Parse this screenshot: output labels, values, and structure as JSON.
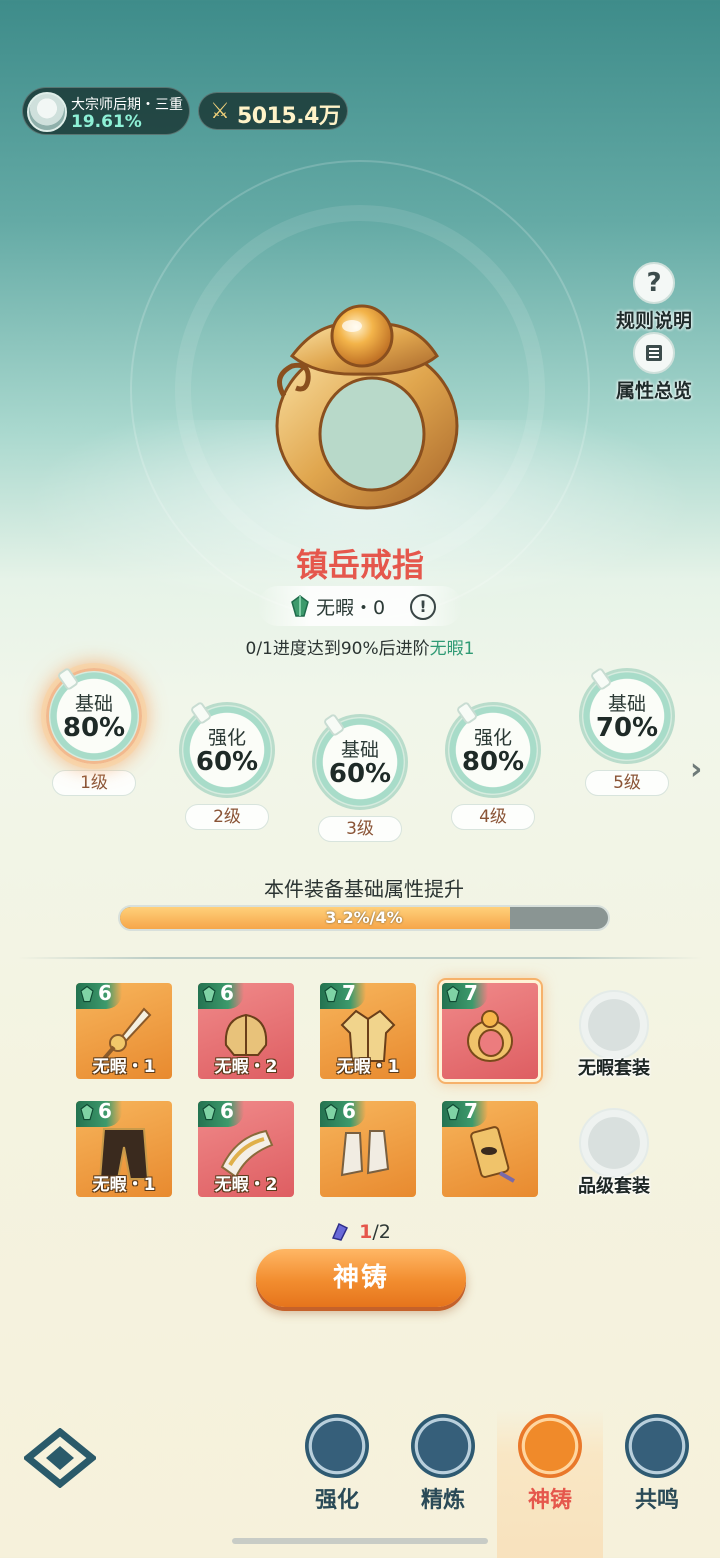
{
  "header": {
    "rank_title": "大宗师后期・三重",
    "rank_progress": "19.61%",
    "power": "5015.4万"
  },
  "side_buttons": {
    "rules_label": "规则说明",
    "attributes_label": "属性总览"
  },
  "item": {
    "name": "镇岳戒指",
    "flaw_label": "无暇・0",
    "progress_prefix": "0/1进度达到90%后进阶",
    "progress_target": "无暇1"
  },
  "stages": [
    {
      "type": "基础",
      "pct": "80%",
      "level": "1级",
      "active": true
    },
    {
      "type": "强化",
      "pct": "60%",
      "level": "2级",
      "active": false
    },
    {
      "type": "基础",
      "pct": "60%",
      "level": "3级",
      "active": false
    },
    {
      "type": "强化",
      "pct": "80%",
      "level": "4级",
      "active": false
    },
    {
      "type": "基础",
      "pct": "70%",
      "level": "5级",
      "active": false
    }
  ],
  "boost": {
    "label": "本件装备基础属性提升",
    "text": "3.2%/4%",
    "fraction": 0.8
  },
  "equipment": [
    {
      "grade": "6",
      "flaw": "无暇・1",
      "color": "orange"
    },
    {
      "grade": "6",
      "flaw": "无暇・2",
      "color": "red"
    },
    {
      "grade": "7",
      "flaw": "无暇・1",
      "color": "orange"
    },
    {
      "grade": "7",
      "flaw": "",
      "color": "red",
      "selected": true
    },
    {
      "grade": "6",
      "flaw": "无暇・1",
      "color": "orange"
    },
    {
      "grade": "6",
      "flaw": "无暇・2",
      "color": "red"
    },
    {
      "grade": "6",
      "flaw": "",
      "color": "orange"
    },
    {
      "grade": "7",
      "flaw": "",
      "color": "orange"
    }
  ],
  "sets": {
    "flawless_label": "无暇套装",
    "grade_label": "品级套装"
  },
  "material": {
    "have": "1",
    "need": "/2"
  },
  "forge_button": "神铸",
  "nav": [
    {
      "label": "强化"
    },
    {
      "label": "精炼"
    },
    {
      "label": "神铸"
    },
    {
      "label": "共鸣"
    }
  ],
  "colors": {
    "accent_red": "#e5574c",
    "accent_orange": "#f28d2f",
    "flaw_green": "#2f9a74"
  }
}
